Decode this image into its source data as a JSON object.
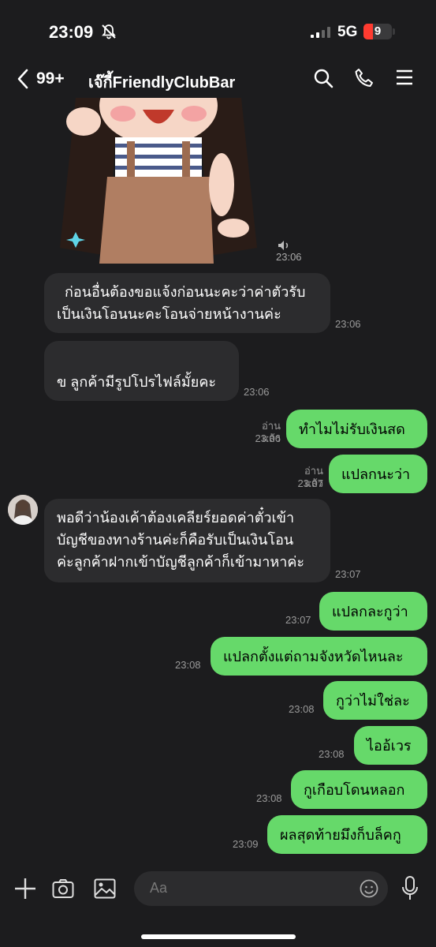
{
  "status": {
    "time": "23:09",
    "network": "5G",
    "battery": "9"
  },
  "header": {
    "unread": "99+",
    "title": "เจ๊กี้FriendlyClubBar"
  },
  "sticker": {
    "time": "23:06"
  },
  "messages": [
    {
      "dir": "in",
      "text": "  ก่อนอื่นต้องขอแจ้งก่อนนะคะว่าค่าตัวรับ\nเป็นเงินโอนนะคะโอนจ่ายหน้างานค่ะ",
      "time": "23:06"
    },
    {
      "dir": "in",
      "text": "\nข ลูกค้ามีรูปโปรไฟล์มั้ยคะ",
      "time": "23:06"
    },
    {
      "dir": "out",
      "text": "ทำไมไม่รับเงินสด",
      "read": "อ่านแล้ว",
      "time": "23:06"
    },
    {
      "dir": "out",
      "text": "แปลกนะว่า",
      "read": "อ่านแล้ว",
      "time": "23:07"
    },
    {
      "dir": "in",
      "text": "พอดีว่าน้องเค้าต้องเคลียร์ยอดค่าตั๋วเข้า\nบัญชีของทางร้านค่ะก็คือรับเป็นเงินโอน\nค่ะลูกค้าฝากเข้าบัญชีลูกค้าก็เข้ามาหาค่ะ",
      "time": "23:07"
    },
    {
      "dir": "out",
      "text": "แปลกละกูว่า",
      "time": "23:07"
    },
    {
      "dir": "out",
      "text": "แปลกตั้งแต่ถามจังหวัดไหนละ",
      "time": "23:08"
    },
    {
      "dir": "out",
      "text": "กูว่าไม่ใช่ละ",
      "time": "23:08"
    },
    {
      "dir": "out",
      "text": "ไออ้เวร",
      "time": "23:08"
    },
    {
      "dir": "out",
      "text": "กูเกือบโดนหลอก",
      "time": "23:08"
    },
    {
      "dir": "out",
      "text": "ผลสุดท้ายมึงก็บล็คกู",
      "time": "23:09"
    }
  ],
  "composer": {
    "placeholder": "Aa"
  },
  "colors": {
    "outgoing": "#66d96a",
    "incoming": "#2c2c2e",
    "background": "#1c1c1e"
  }
}
